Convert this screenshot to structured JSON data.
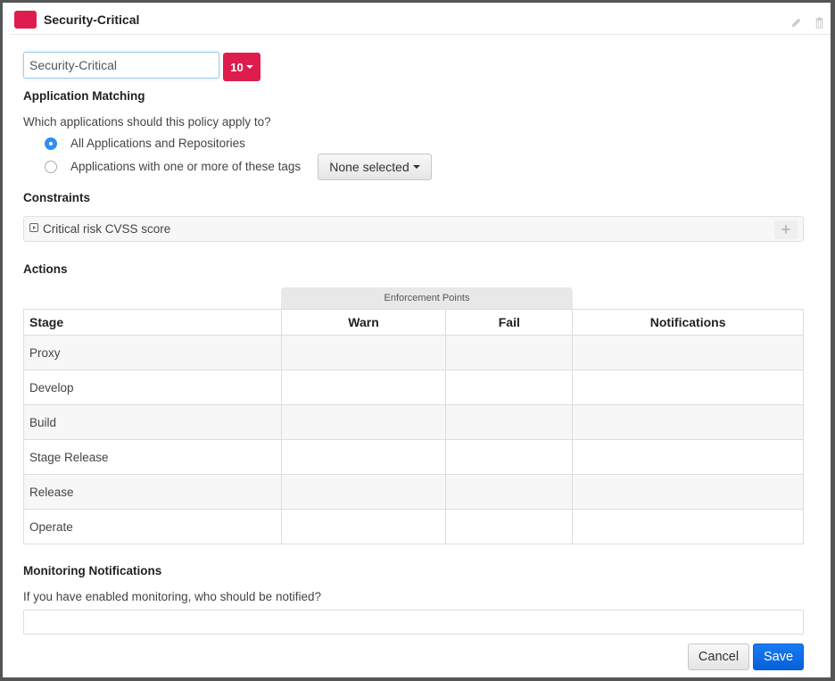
{
  "header": {
    "title": "Security-Critical",
    "color": "#de1d4e",
    "icons": [
      "pencil-icon",
      "trash-icon"
    ]
  },
  "policy": {
    "name_value": "Security-Critical",
    "threat_level": "10",
    "threat_color": "#de1d4e"
  },
  "app_matching": {
    "title": "Application Matching",
    "question": "Which applications should this policy apply to?",
    "options": [
      {
        "label": "All Applications and Repositories",
        "checked": true
      },
      {
        "label": "Applications with one or more of these tags",
        "checked": false
      }
    ],
    "tags_dropdown": "None selected"
  },
  "constraints": {
    "title": "Constraints",
    "items": [
      {
        "label": "Critical risk CVSS score"
      }
    ],
    "add_icon": "plus-icon"
  },
  "actions": {
    "title": "Actions",
    "group_header": "Enforcement Points",
    "columns": [
      "Stage",
      "Warn",
      "Fail",
      "Notifications"
    ],
    "rows": [
      {
        "stage": "Proxy",
        "warn": "",
        "fail": "",
        "notifications": ""
      },
      {
        "stage": "Develop",
        "warn": "",
        "fail": "",
        "notifications": ""
      },
      {
        "stage": "Build",
        "warn": "",
        "fail": "",
        "notifications": ""
      },
      {
        "stage": "Stage Release",
        "warn": "",
        "fail": "",
        "notifications": ""
      },
      {
        "stage": "Release",
        "warn": "",
        "fail": "",
        "notifications": ""
      },
      {
        "stage": "Operate",
        "warn": "",
        "fail": "",
        "notifications": ""
      }
    ]
  },
  "monitoring": {
    "title": "Monitoring Notifications",
    "question": "If you have enabled monitoring, who should be notified?",
    "value": ""
  },
  "footer": {
    "cancel_label": "Cancel",
    "save_label": "Save",
    "save_color": "#0b67e0"
  }
}
